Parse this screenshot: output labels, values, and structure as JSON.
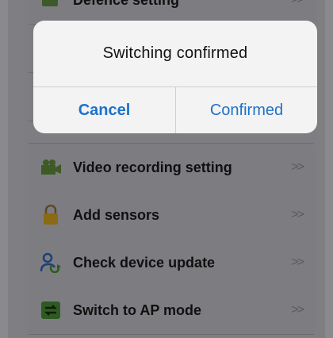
{
  "background_list": {
    "top_partial_label": "Defence setting",
    "items": [
      {
        "label": "Video recording setting",
        "icon": "video-camera-icon",
        "chevron": ">>"
      },
      {
        "label": "Add sensors",
        "icon": "lock-icon",
        "chevron": ">>"
      },
      {
        "label": "Check device update",
        "icon": "user-update-icon",
        "chevron": ">>"
      },
      {
        "label": "Switch to AP mode",
        "icon": "switch-arrows-icon",
        "chevron": ">>"
      }
    ]
  },
  "dialog": {
    "title": "Switching confirmed",
    "cancel_label": "Cancel",
    "confirm_label": "Confirmed"
  },
  "colors": {
    "accent": "#1e72c8",
    "dim_overlay": "#7f7f83",
    "dialog_bg": "#f3f3f3"
  }
}
